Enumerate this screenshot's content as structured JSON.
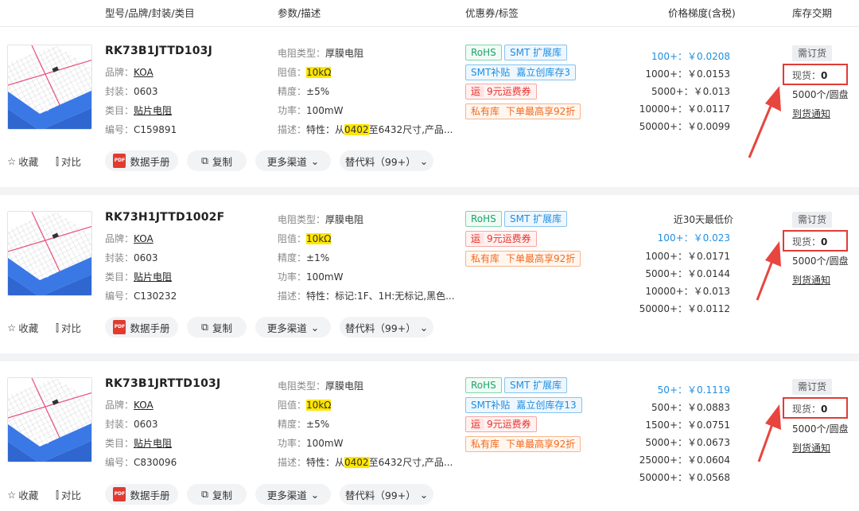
{
  "header": {
    "col_model": "型号/品牌/封装/类目",
    "col_params": "参数/描述",
    "col_tags": "优惠券/标签",
    "col_price": "价格梯度(含税)",
    "col_stock": "库存交期"
  },
  "labels": {
    "brand": "品牌：",
    "package": "封装：",
    "category": "类目：",
    "code": "编号：",
    "resistor_type": "电阻类型：",
    "resistance": "阻值：",
    "accuracy": "精度：",
    "power": "功率：",
    "description": "描述：",
    "order": "需订货",
    "stock": "现货：",
    "notify": "到货通知",
    "favorite": "收藏",
    "compare": "对比",
    "datasheet": "数据手册",
    "copy": "复制",
    "more_channels": "更多渠道",
    "substitute": "替代料（99+）",
    "rohs": "RoHS",
    "smt_expand": "SMT  扩展库",
    "freight_icon": "运",
    "freight": "9元运费券",
    "private": "私有库",
    "private_discount": "下单最高享92折",
    "smt_supplement": "SMT补贴",
    "jlc_stock": "嘉立创库存"
  },
  "products": [
    {
      "part_number": "RK73B1JTTD103J",
      "brand": "KOA",
      "package": "0603",
      "category": "贴片电阻",
      "code": "C159891",
      "resistor_type": "厚膜电阻",
      "resistance": "10kΩ",
      "accuracy": "±5%",
      "power": "100mW",
      "desc_prefix": "特性：从",
      "desc_highlight": "0402",
      "desc_suffix": "至6432尺寸,产品...",
      "jlc_stock_count": "3",
      "price_note": "",
      "prices": [
        "100+：￥0.0208",
        "1000+：￥0.0153",
        "5000+：￥0.013",
        "10000+：￥0.0117",
        "50000+：￥0.0099"
      ],
      "stock_value": "0",
      "reel": "5000个/圆盘"
    },
    {
      "part_number": "RK73H1JTTD1002F",
      "brand": "KOA",
      "package": "0603",
      "category": "贴片电阻",
      "code": "C130232",
      "resistor_type": "厚膜电阻",
      "resistance": "10kΩ",
      "accuracy": "±1%",
      "power": "100mW",
      "desc_prefix": "特性：标记:1F、1H:无标记,黑色...",
      "desc_highlight": "",
      "desc_suffix": "",
      "jlc_stock_count": "",
      "price_note": "近30天最低价",
      "prices": [
        "100+：￥0.023",
        "1000+：￥0.0171",
        "5000+：￥0.0144",
        "10000+：￥0.013",
        "50000+：￥0.0112"
      ],
      "stock_value": "0",
      "reel": "5000个/圆盘"
    },
    {
      "part_number": "RK73B1JRTTD103J",
      "brand": "KOA",
      "package": "0603",
      "category": "贴片电阻",
      "code": "C830096",
      "resistor_type": "厚膜电阻",
      "resistance": "10kΩ",
      "accuracy": "±5%",
      "power": "100mW",
      "desc_prefix": "特性：从",
      "desc_highlight": "0402",
      "desc_suffix": "至6432尺寸,产品...",
      "jlc_stock_count": "13",
      "price_note": "",
      "prices": [
        "50+：￥0.1119",
        "500+：￥0.0883",
        "1500+：￥0.0751",
        "5000+：￥0.0673",
        "25000+：￥0.0604",
        "50000+：￥0.0568"
      ],
      "stock_value": "0",
      "reel": "5000个/圆盘"
    }
  ],
  "colors": {
    "accent_blue": "#1f8ee0",
    "highlight_red": "#e23b36",
    "highlight_yellow": "#ffe600"
  }
}
